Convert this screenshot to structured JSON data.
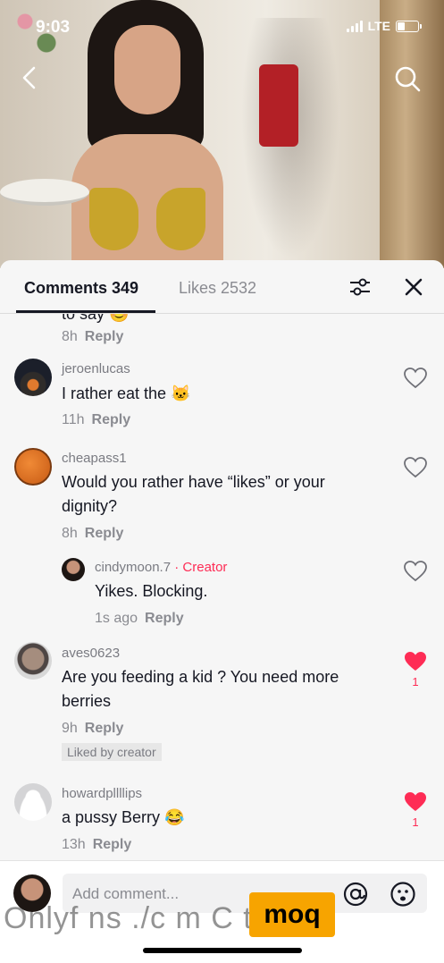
{
  "status_bar": {
    "time": "9:03",
    "network": "LTE"
  },
  "tabs": {
    "comments": "Comments 349",
    "likes": "Likes 2532"
  },
  "comments": [
    {
      "partial_text": "to say 😊",
      "time": "8h",
      "reply": "Reply"
    },
    {
      "user": "jeroenlucas",
      "text": "I rather eat the 🐱",
      "time": "11h",
      "reply": "Reply"
    },
    {
      "user": "cheapass1",
      "text": "Would you rather have “likes” or your dignity?",
      "time": "8h",
      "reply": "Reply"
    },
    {
      "user": "cindymoon.7",
      "creator_label": " · Creator",
      "text": "Yikes. Blocking.",
      "time": "1s ago",
      "reply": "Reply"
    },
    {
      "user": "aves0623",
      "text": "Are you feeding a kid ? You need more berries",
      "time": "9h",
      "reply": "Reply",
      "likes": "1",
      "liked_badge": "Liked by creator"
    },
    {
      "user": "howardpllllips",
      "text": "a pussy Berry 😂",
      "time": "13h",
      "reply": "Reply",
      "likes": "1"
    }
  ],
  "composer": {
    "placeholder": "Add comment..."
  },
  "watermark": {
    "text": "Onlyf ns ./c m C       t:cdn7",
    "badge": "moq"
  },
  "colors": {
    "accent": "#fe2c55",
    "text": "#161823",
    "muted": "#8a8b91"
  }
}
